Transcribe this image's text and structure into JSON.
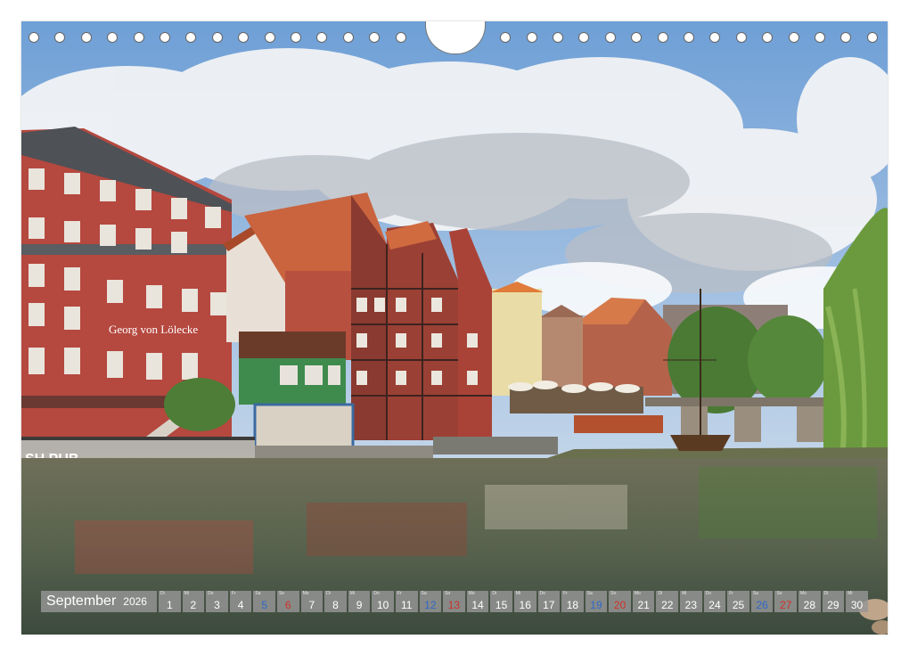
{
  "calendar": {
    "month": "September",
    "year": "2026",
    "days": [
      {
        "n": "1",
        "wd": "Di",
        "type": "weekday"
      },
      {
        "n": "2",
        "wd": "Mi",
        "type": "weekday"
      },
      {
        "n": "3",
        "wd": "Do",
        "type": "weekday"
      },
      {
        "n": "4",
        "wd": "Fr",
        "type": "weekday"
      },
      {
        "n": "5",
        "wd": "Sa",
        "type": "sat"
      },
      {
        "n": "6",
        "wd": "So",
        "type": "sun"
      },
      {
        "n": "7",
        "wd": "Mo",
        "type": "weekday"
      },
      {
        "n": "8",
        "wd": "Di",
        "type": "weekday"
      },
      {
        "n": "9",
        "wd": "Mi",
        "type": "weekday"
      },
      {
        "n": "10",
        "wd": "Do",
        "type": "weekday"
      },
      {
        "n": "11",
        "wd": "Fr",
        "type": "weekday"
      },
      {
        "n": "12",
        "wd": "Sa",
        "type": "sat"
      },
      {
        "n": "13",
        "wd": "So",
        "type": "sun"
      },
      {
        "n": "14",
        "wd": "Mo",
        "type": "weekday"
      },
      {
        "n": "15",
        "wd": "Di",
        "type": "weekday"
      },
      {
        "n": "16",
        "wd": "Mi",
        "type": "weekday"
      },
      {
        "n": "17",
        "wd": "Do",
        "type": "weekday"
      },
      {
        "n": "18",
        "wd": "Fr",
        "type": "weekday"
      },
      {
        "n": "19",
        "wd": "Sa",
        "type": "sat"
      },
      {
        "n": "20",
        "wd": "So",
        "type": "sun"
      },
      {
        "n": "21",
        "wd": "Mo",
        "type": "weekday"
      },
      {
        "n": "22",
        "wd": "Di",
        "type": "weekday"
      },
      {
        "n": "23",
        "wd": "Mi",
        "type": "weekday"
      },
      {
        "n": "24",
        "wd": "Do",
        "type": "weekday"
      },
      {
        "n": "25",
        "wd": "Fr",
        "type": "weekday"
      },
      {
        "n": "26",
        "wd": "Sa",
        "type": "sat"
      },
      {
        "n": "27",
        "wd": "So",
        "type": "sun"
      },
      {
        "n": "28",
        "wd": "Mo",
        "type": "weekday"
      },
      {
        "n": "29",
        "wd": "Di",
        "type": "weekday"
      },
      {
        "n": "30",
        "wd": "Mi",
        "type": "weekday"
      }
    ]
  },
  "photo": {
    "facade_sign": "Georg von Lölecke",
    "pub_sign": "SH PUB"
  },
  "colors": {
    "sky": "#7fa9d8",
    "brick": "#b5483f",
    "water": "#5d6a52",
    "saturday": "#2f68c9",
    "sunday": "#d2302a"
  }
}
